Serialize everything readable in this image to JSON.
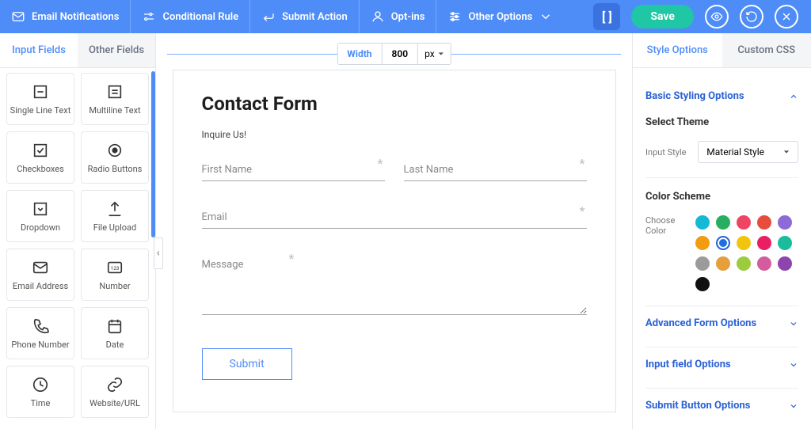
{
  "topbar": {
    "items": [
      {
        "label": "Email Notifications",
        "name": "email-notifications"
      },
      {
        "label": "Conditional Rule",
        "name": "conditional-rule"
      },
      {
        "label": "Submit Action",
        "name": "submit-action"
      },
      {
        "label": "Opt-ins",
        "name": "opt-ins"
      },
      {
        "label": "Other Options",
        "name": "other-options",
        "dropdown": true
      }
    ],
    "save": "Save"
  },
  "left_tabs": {
    "active": "Input Fields",
    "inactive": "Other Fields"
  },
  "fields": [
    {
      "label": "Single Line Text",
      "name": "single-line-text",
      "icon": "box-line"
    },
    {
      "label": "Multiline Text",
      "name": "multiline-text",
      "icon": "box-lines"
    },
    {
      "label": "Checkboxes",
      "name": "checkboxes",
      "icon": "check-square"
    },
    {
      "label": "Radio Buttons",
      "name": "radio-buttons",
      "icon": "radio"
    },
    {
      "label": "Dropdown",
      "name": "dropdown",
      "icon": "chev-square"
    },
    {
      "label": "File Upload",
      "name": "file-upload",
      "icon": "upload"
    },
    {
      "label": "Email Address",
      "name": "email-address",
      "icon": "mail"
    },
    {
      "label": "Number",
      "name": "number",
      "icon": "123"
    },
    {
      "label": "Phone Number",
      "name": "phone-number",
      "icon": "phone"
    },
    {
      "label": "Date",
      "name": "date",
      "icon": "calendar"
    },
    {
      "label": "Time",
      "name": "time",
      "icon": "clock"
    },
    {
      "label": "Website/URL",
      "name": "website-url",
      "icon": "link"
    }
  ],
  "canvas": {
    "width_label": "Width",
    "width_value": "800",
    "width_unit": "px",
    "title": "Contact Form",
    "subtitle": "Inquire Us!",
    "first_name": "First Name",
    "last_name": "Last Name",
    "email": "Email",
    "message": "Message",
    "submit": "Submit"
  },
  "right_tabs": {
    "active": "Style Options",
    "inactive": "Custom CSS"
  },
  "style": {
    "basic_header": "Basic Styling Options",
    "select_theme": "Select Theme",
    "input_style_label": "Input Style",
    "input_style_value": "Material Style",
    "color_scheme": "Color Scheme",
    "choose_color": "Choose Color",
    "colors": [
      "#14b9d6",
      "#27ae60",
      "#ef4565",
      "#e74c3c",
      "#8e6ad6",
      "#f39c12",
      "#1e6fe0",
      "#f1c40f",
      "#e91e63",
      "#1abc9c",
      "#9b9b9b",
      "#e79f3c",
      "#9ccc3c",
      "#d35c9e",
      "#8e44ad",
      "#111111"
    ],
    "selected_color_index": 6,
    "sections": [
      "Advanced Form Options",
      "Input field Options",
      "Submit Button Options"
    ]
  }
}
